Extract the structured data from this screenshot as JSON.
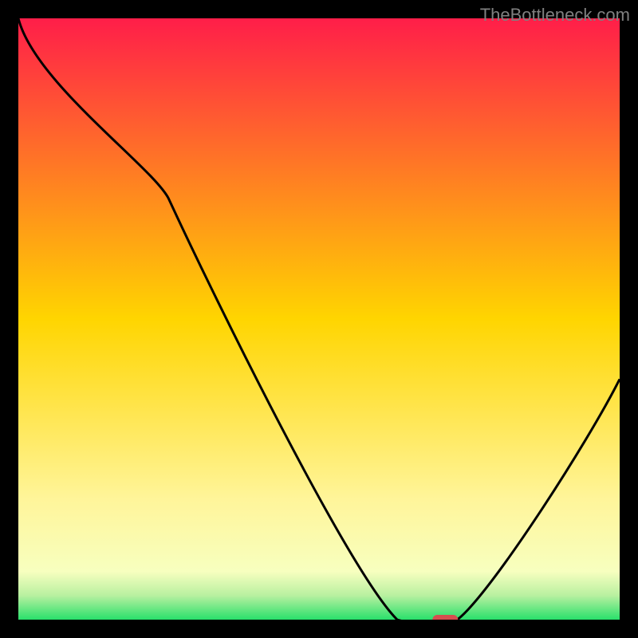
{
  "watermark": "TheBottleneck.com",
  "chart_data": {
    "type": "line",
    "title": "",
    "xlabel": "",
    "ylabel": "",
    "xlim": [
      0,
      100
    ],
    "ylim": [
      0,
      100
    ],
    "series": [
      {
        "name": "bottleneck-curve",
        "x": [
          0,
          25,
          63,
          70,
          73,
          100
        ],
        "y": [
          100,
          70,
          0,
          0,
          0,
          40
        ]
      }
    ],
    "optimal_marker": {
      "x": 71,
      "y": 0,
      "color": "#d64f4f"
    },
    "gradient_stops": [
      {
        "offset": 0,
        "color": "#ff1e49"
      },
      {
        "offset": 50,
        "color": "#ffd500"
      },
      {
        "offset": 80,
        "color": "#fff59a"
      },
      {
        "offset": 92,
        "color": "#f7ffbf"
      },
      {
        "offset": 96,
        "color": "#b8f0a0"
      },
      {
        "offset": 100,
        "color": "#29e06b"
      }
    ]
  }
}
